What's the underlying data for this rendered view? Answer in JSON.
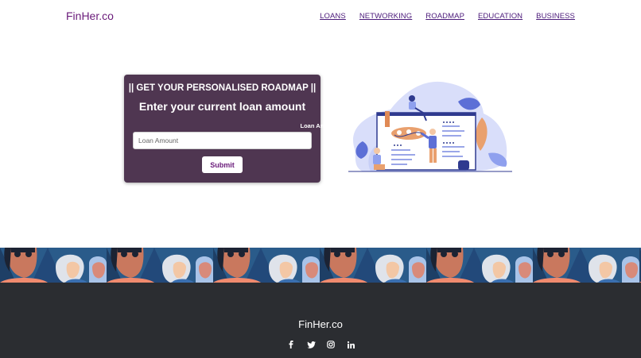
{
  "header": {
    "brand": "FinHer.co",
    "nav": [
      "LOANS",
      "NETWORKING",
      "ROADMAP",
      "EDUCATION",
      "BUSINESS"
    ]
  },
  "form": {
    "heading": "|| GET YOUR PERSONALISED ROADMAP ||",
    "title": "Enter your current loan amount",
    "field_label": "Loan Amount*",
    "field_placeholder": "Loan Amount",
    "field_value": "",
    "submit_label": "Submit"
  },
  "illustration": {
    "icon": "roadmap-planning-illustration"
  },
  "footer": {
    "brand": "FinHer.co",
    "social_icons": [
      "facebook-icon",
      "twitter-icon",
      "instagram-icon",
      "linkedin-icon"
    ]
  },
  "colors": {
    "brand": "#6a1b7a",
    "nav_link": "#4b1a7a",
    "card_bg": "#4f3651",
    "footer_bg": "#2b2d31",
    "band_bg": "#2c5a86"
  }
}
